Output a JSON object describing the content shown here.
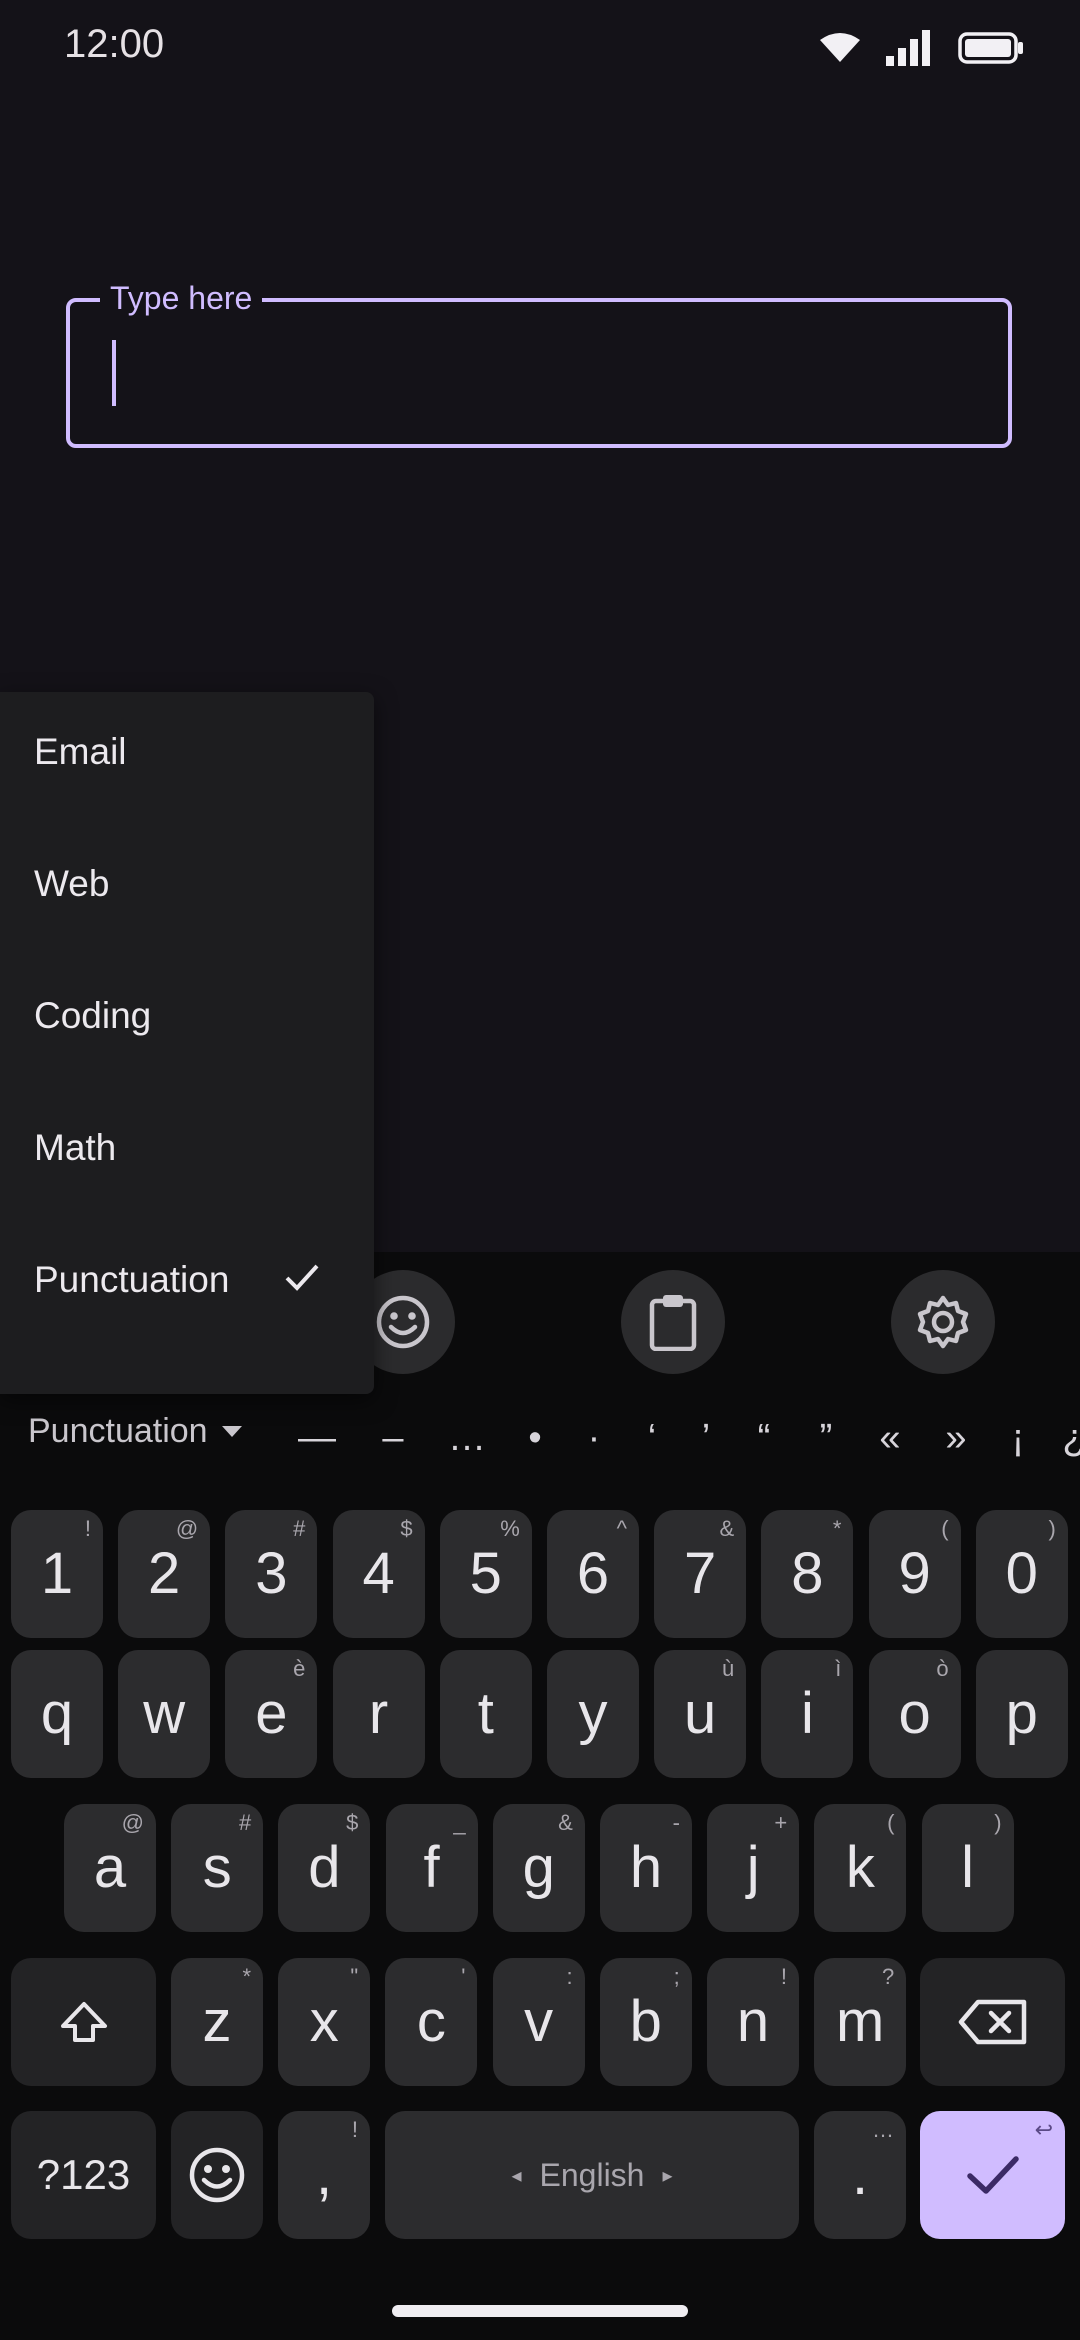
{
  "status": {
    "time": "12:00"
  },
  "field": {
    "label": "Type here",
    "value": ""
  },
  "menu": {
    "items": [
      {
        "label": "Email",
        "checked": false
      },
      {
        "label": "Web",
        "checked": false
      },
      {
        "label": "Coding",
        "checked": false
      },
      {
        "label": "Math",
        "checked": false
      },
      {
        "label": "Punctuation",
        "checked": true
      }
    ]
  },
  "toolbar": {
    "icons": [
      "emoji-icon",
      "clipboard-icon",
      "gear-icon"
    ]
  },
  "symbol_bar": {
    "category": "Punctuation",
    "symbols": [
      "—",
      "–",
      "…",
      "•",
      "·",
      "‘",
      "’",
      "“",
      "”",
      "«",
      "»",
      "¡",
      "¿"
    ]
  },
  "keys": {
    "numbers": [
      {
        "main": "1",
        "hint": "!"
      },
      {
        "main": "2",
        "hint": "@"
      },
      {
        "main": "3",
        "hint": "#"
      },
      {
        "main": "4",
        "hint": "$"
      },
      {
        "main": "5",
        "hint": "%"
      },
      {
        "main": "6",
        "hint": "^"
      },
      {
        "main": "7",
        "hint": "&"
      },
      {
        "main": "8",
        "hint": "*"
      },
      {
        "main": "9",
        "hint": "("
      },
      {
        "main": "0",
        "hint": ")"
      }
    ],
    "row1": [
      {
        "main": "q",
        "hint": ""
      },
      {
        "main": "w",
        "hint": ""
      },
      {
        "main": "e",
        "hint": "è"
      },
      {
        "main": "r",
        "hint": ""
      },
      {
        "main": "t",
        "hint": ""
      },
      {
        "main": "y",
        "hint": ""
      },
      {
        "main": "u",
        "hint": "ù"
      },
      {
        "main": "i",
        "hint": "ì"
      },
      {
        "main": "o",
        "hint": "ò"
      },
      {
        "main": "p",
        "hint": ""
      }
    ],
    "row2": [
      {
        "main": "a",
        "hint": "@"
      },
      {
        "main": "s",
        "hint": "#"
      },
      {
        "main": "d",
        "hint": "$"
      },
      {
        "main": "f",
        "hint": "_"
      },
      {
        "main": "g",
        "hint": "&"
      },
      {
        "main": "h",
        "hint": "-"
      },
      {
        "main": "j",
        "hint": "+"
      },
      {
        "main": "k",
        "hint": "("
      },
      {
        "main": "l",
        "hint": ")"
      }
    ],
    "row3": [
      {
        "main": "z",
        "hint": "*"
      },
      {
        "main": "x",
        "hint": "\""
      },
      {
        "main": "c",
        "hint": "'"
      },
      {
        "main": "v",
        "hint": ":"
      },
      {
        "main": "b",
        "hint": ";"
      },
      {
        "main": "n",
        "hint": "!"
      },
      {
        "main": "m",
        "hint": "?"
      }
    ],
    "bottom": {
      "symbols_label": "?123",
      "comma": ",",
      "comma_hint": "!",
      "space_label": "English",
      "period": ".",
      "period_hint": "…",
      "enter_hint": "↩"
    }
  },
  "colors": {
    "accent": "#d0bcff",
    "background": "#141218",
    "key": "#2c2c2e"
  }
}
